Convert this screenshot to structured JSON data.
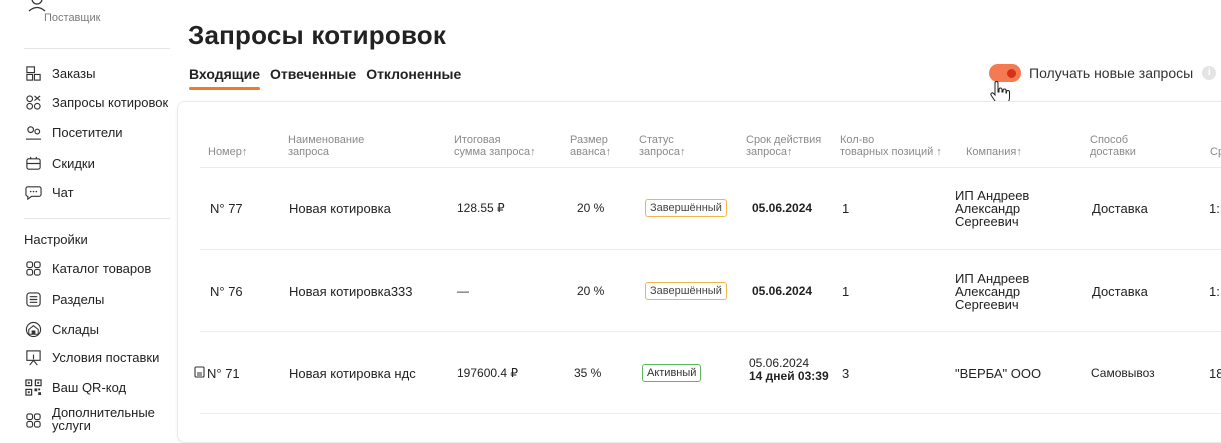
{
  "sidebar": {
    "user_role": "Поставщик",
    "items": [
      {
        "label": "Заказы",
        "icon": "orders-icon"
      },
      {
        "label": "Запросы котировок",
        "icon": "quotes-icon"
      },
      {
        "label": "Посетители",
        "icon": "visitors-icon"
      },
      {
        "label": "Скидки",
        "icon": "discounts-icon"
      },
      {
        "label": "Чат",
        "icon": "chat-icon"
      }
    ],
    "settings_title": "Настройки",
    "settings_items": [
      {
        "label": "Каталог товаров",
        "icon": "catalog-icon"
      },
      {
        "label": "Разделы",
        "icon": "sections-icon"
      },
      {
        "label": "Склады",
        "icon": "warehouse-icon"
      },
      {
        "label": "Условия поставки",
        "icon": "delivery-terms-icon"
      },
      {
        "label": "Ваш QR-код",
        "icon": "qr-code-icon"
      },
      {
        "label": "Дополнительные услуги",
        "icon": "extra-services-icon"
      }
    ]
  },
  "page": {
    "title": "Запросы котировок",
    "tabs": [
      {
        "label": "Входящие",
        "active": true
      },
      {
        "label": "Отвеченные",
        "active": false
      },
      {
        "label": "Отклоненные",
        "active": false
      }
    ],
    "toggle_label": "Получать новые запросы",
    "toggle_on": true,
    "info_symbol": "i"
  },
  "table": {
    "headers": {
      "number": "Номер↑",
      "name": [
        "Наименование",
        "запроса"
      ],
      "total": [
        "Итоговая",
        "сумма запроса↑"
      ],
      "advance": [
        "Размер",
        "аванса↑"
      ],
      "status": [
        "Статус",
        "запроса↑"
      ],
      "validity": [
        "Срок действия",
        "запроса↑"
      ],
      "positions": [
        "Кол-во",
        "товарных позиций ↑"
      ],
      "company": "Компания↑",
      "delivery": [
        "Способ",
        "доставки"
      ],
      "cut": "Ср"
    },
    "rows": [
      {
        "number": "N° 77",
        "name": "Новая котировка",
        "total": "128.55 ₽",
        "advance": "20 %",
        "status": "Завершённый",
        "status_type": "done",
        "validity": "05.06.2024",
        "validity_extra": "",
        "positions": "1",
        "company": [
          "ИП Андреев",
          "Александр",
          "Сергеевич"
        ],
        "delivery": "Доставка",
        "cut": "1:"
      },
      {
        "number": "N° 76",
        "name": "Новая котировка333",
        "total": "—",
        "advance": "20 %",
        "status": "Завершённый",
        "status_type": "done",
        "validity": "05.06.2024",
        "validity_extra": "",
        "positions": "1",
        "company": [
          "ИП Андреев",
          "Александр",
          "Сергеевич"
        ],
        "delivery": "Доставка",
        "cut": "1:"
      },
      {
        "number": "N° 71",
        "name": "Новая котировка ндс",
        "total": "197600.4 ₽",
        "advance": "35 %",
        "status": "Активный",
        "status_type": "active",
        "validity": "05.06.2024",
        "validity_extra": "14 дней 03:39",
        "positions": "3",
        "company": [
          "\"ВЕРБА\" ООО"
        ],
        "delivery": "Самовывоз",
        "cut": "18"
      }
    ]
  },
  "colors": {
    "accent": "#f07a2a",
    "toggle_bg": "#f47a52",
    "toggle_knob": "#d8311b",
    "badge_done": "#f0b64a",
    "badge_active": "#5cb85c"
  }
}
